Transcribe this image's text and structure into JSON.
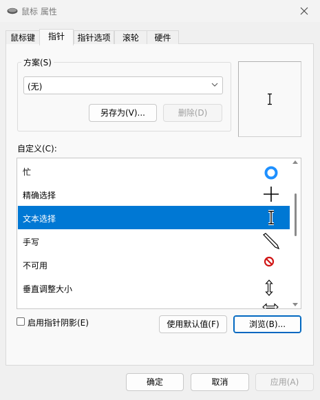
{
  "window": {
    "title": "鼠标 属性"
  },
  "tabs": [
    {
      "label": "鼠标键"
    },
    {
      "label": "指针"
    },
    {
      "label": "指针选项"
    },
    {
      "label": "滚轮"
    },
    {
      "label": "硬件"
    }
  ],
  "scheme": {
    "label": "方案(S)",
    "selected": "(无)",
    "save_as": "另存为(V)...",
    "delete": "删除(D)"
  },
  "customize": {
    "label": "自定义(C):",
    "rows": [
      {
        "label": "忙",
        "icon": "busy-ring-icon"
      },
      {
        "label": "精确选择",
        "icon": "crosshair-icon"
      },
      {
        "label": "文本选择",
        "icon": "text-beam-icon"
      },
      {
        "label": "手写",
        "icon": "pen-icon"
      },
      {
        "label": "不可用",
        "icon": "unavailable-icon"
      },
      {
        "label": "垂直调整大小",
        "icon": "vertical-resize-icon"
      },
      {
        "label": "",
        "icon": "horizontal-resize-icon"
      }
    ],
    "selected_index": 2
  },
  "options": {
    "shadow_label": "启用指针阴影(E)",
    "shadow_checked": false,
    "use_default": "使用默认值(F)",
    "browse": "浏览(B)..."
  },
  "footer": {
    "ok": "确定",
    "cancel": "取消",
    "apply": "应用(A)"
  },
  "colors": {
    "selection": "#0078d4",
    "busy_ring": "#1e90ff",
    "unavailable": "#d01414"
  }
}
